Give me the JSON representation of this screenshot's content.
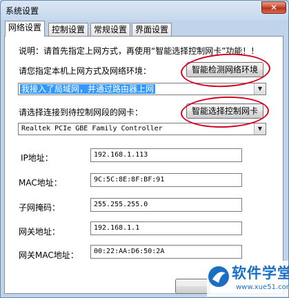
{
  "window": {
    "title": "系统设置",
    "close_label": "✕"
  },
  "tabs": [
    {
      "label": "网络设置",
      "active": true
    },
    {
      "label": "控制设置",
      "active": false
    },
    {
      "label": "常规设置",
      "active": false
    },
    {
      "label": "界面设置",
      "active": false
    }
  ],
  "panel": {
    "note": "说明：请首先指定上网方式，再使用“智能选择控制网卡”功能！！",
    "network_env_label": "请您指定本机上网方式及网络环境：",
    "detect_button": "智能检测网络环境",
    "network_env_value": "我接入了局域网，并通过路由器上网",
    "nic_label": "请选择连接到待控制网段的网卡：",
    "select_nic_button": "智能选择控制网卡",
    "nic_value": "Realtek PCIe GBE Family Controller",
    "fields": [
      {
        "label": "IP地址：",
        "value": "192.168.1.113"
      },
      {
        "label": "MAC地址：",
        "value": "9C:5C:8E:8F:BF:91"
      },
      {
        "label": "子网掩码：",
        "value": "255.255.255.0"
      },
      {
        "label": "网关地址：",
        "value": "192.168.1.1"
      },
      {
        "label": "网关MAC地址：",
        "value": "00:22:AA:D6:50:2A"
      }
    ]
  },
  "watermark": {
    "brand": "软件学堂",
    "url": "www.xue51.com"
  },
  "colors": {
    "selection": "#3399ff",
    "annotation": "#d8001e",
    "watermark": "#1a6fc4"
  }
}
